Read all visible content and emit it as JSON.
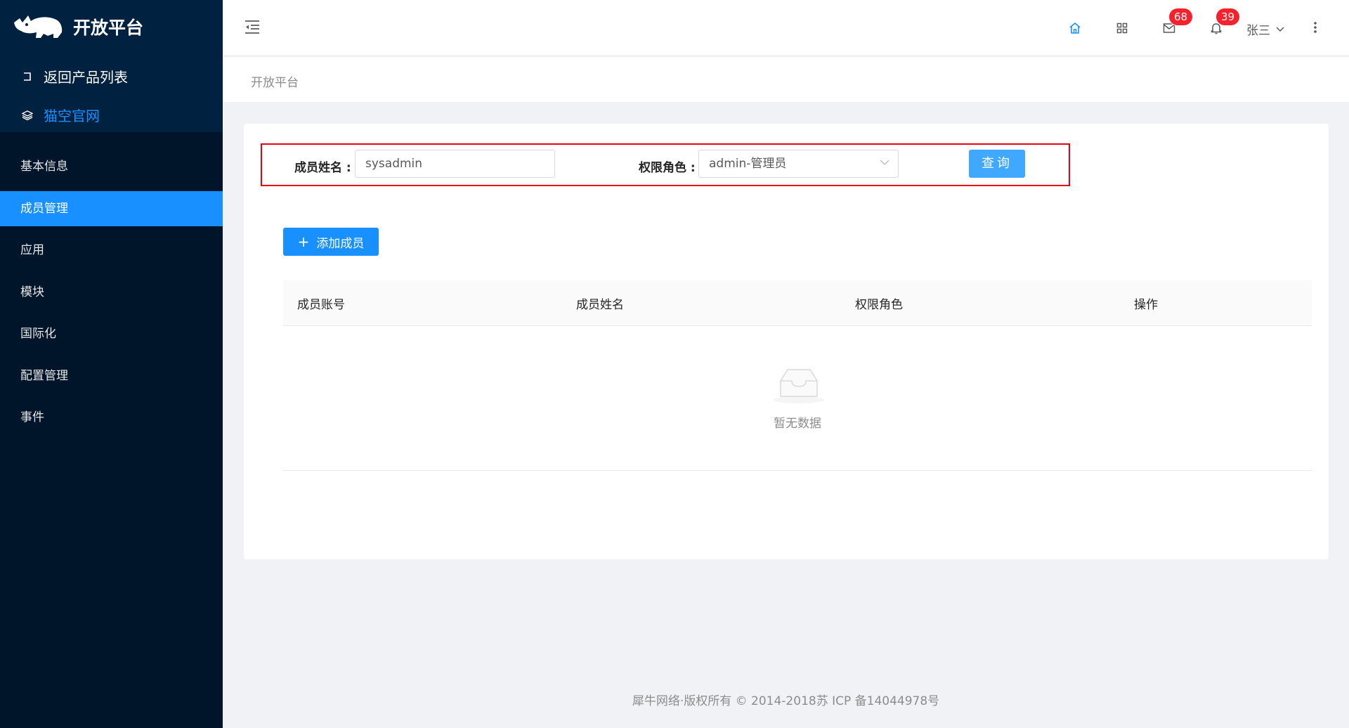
{
  "sidebar": {
    "logo_text": "开放平台",
    "back_link": "返回产品列表",
    "site_link": "猫空官网",
    "items": [
      {
        "label": "基本信息",
        "active": false
      },
      {
        "label": "成员管理",
        "active": true
      },
      {
        "label": "应用",
        "active": false
      },
      {
        "label": "模块",
        "active": false
      },
      {
        "label": "国际化",
        "active": false
      },
      {
        "label": "配置管理",
        "active": false
      },
      {
        "label": "事件",
        "active": false
      }
    ]
  },
  "header": {
    "mail_badge": "68",
    "bell_badge": "39",
    "user_name": "张三"
  },
  "breadcrumb": "开放平台",
  "filter": {
    "name_label": "成员姓名",
    "name_value": "sysadmin",
    "role_label": "权限角色",
    "role_value": "admin-管理员",
    "query_button": "查询"
  },
  "add_button": "添加成员",
  "table": {
    "columns": [
      "成员账号",
      "成员姓名",
      "权限角色",
      "操作"
    ],
    "empty_text": "暂无数据"
  },
  "footer": "犀牛网络·版权所有 © 2014-2018苏 ICP 备14044978号",
  "colors": {
    "primary": "#1890ff",
    "sidebar_bg": "#001529",
    "badge": "#f5222d",
    "highlight_box": "#e60012"
  }
}
